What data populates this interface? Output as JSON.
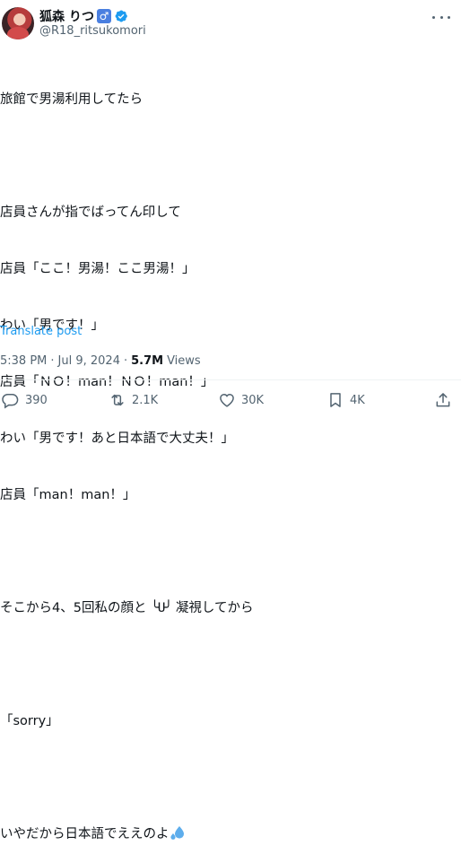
{
  "author": {
    "name": "狐森 りつ",
    "gender_symbol": "♂",
    "handle": "@R18_ritsukomori",
    "verified": true
  },
  "tweet": {
    "lines": [
      "旅館で男湯利用してたら",
      "",
      "店員さんが指でばってん印して",
      "店員「ここ！男湯！ここ男湯！」",
      "わい「男です！」",
      "店員「ＮＯ！man！ＮＯ！man！」",
      "わい「男です！あと日本語で大丈夫！」",
      "店員「man！man！」",
      "",
      "そこから4、5回私の顔と",
      "",
      "「sorry」",
      "",
      "いやだから日本語でええのよ"
    ],
    "face_emoji": "╰U╯",
    "line10_suffix": " 凝視してから"
  },
  "translate_label": "Translate post",
  "meta": {
    "time": "5:38 PM",
    "separator": "·",
    "date": "Jul 9, 2024",
    "views_count": "5.7M",
    "views_label": "Views"
  },
  "actions": {
    "replies": "390",
    "reposts": "2.1K",
    "likes": "30K",
    "bookmarks": "4K"
  },
  "colors": {
    "text": "#0f1419",
    "secondary": "#536471",
    "link": "#1d9bf0",
    "verified": "#1d9bf0"
  }
}
